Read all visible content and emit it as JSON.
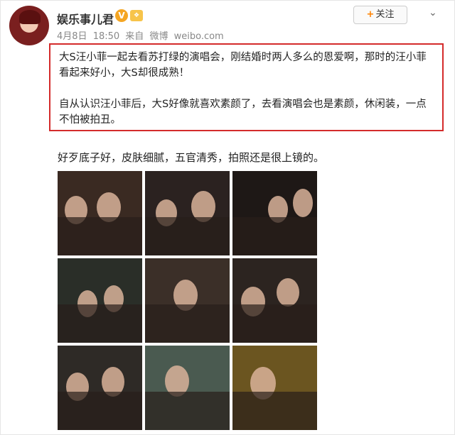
{
  "post": {
    "username": "娱乐事儿君",
    "verified_badge": "V",
    "level_badge": "",
    "date": "4月8日",
    "time": "18:50",
    "source_prefix": "来自",
    "source": "微博",
    "source_domain": "weibo.com",
    "follow_label": "关注",
    "quote_paragraph_1": "大S汪小菲一起去看苏打绿的演唱会，刚结婚时两人多么的恩爱啊，那时的汪小菲看起来好小，大S却很成熟！",
    "quote_paragraph_2": "自从认识汪小菲后，大S好像就喜欢素颜了，去看演唱会也是素颜，休闲装，一点不怕被拍丑。",
    "caption": "好歹底子好，皮肤细腻，五官清秀，拍照还是很上镜的。"
  },
  "photos": [
    {
      "bg": "#3a2a22"
    },
    {
      "bg": "#2b2220"
    },
    {
      "bg": "#1e1816"
    },
    {
      "bg": "#2a2e28"
    },
    {
      "bg": "#3b2f28"
    },
    {
      "bg": "#2c2420"
    },
    {
      "bg": "#2e2a26"
    },
    {
      "bg": "#4a5a50"
    },
    {
      "bg": "#6b5520"
    }
  ],
  "colors": {
    "highlight_border": "#d42b2b",
    "accent": "#ff8200"
  }
}
